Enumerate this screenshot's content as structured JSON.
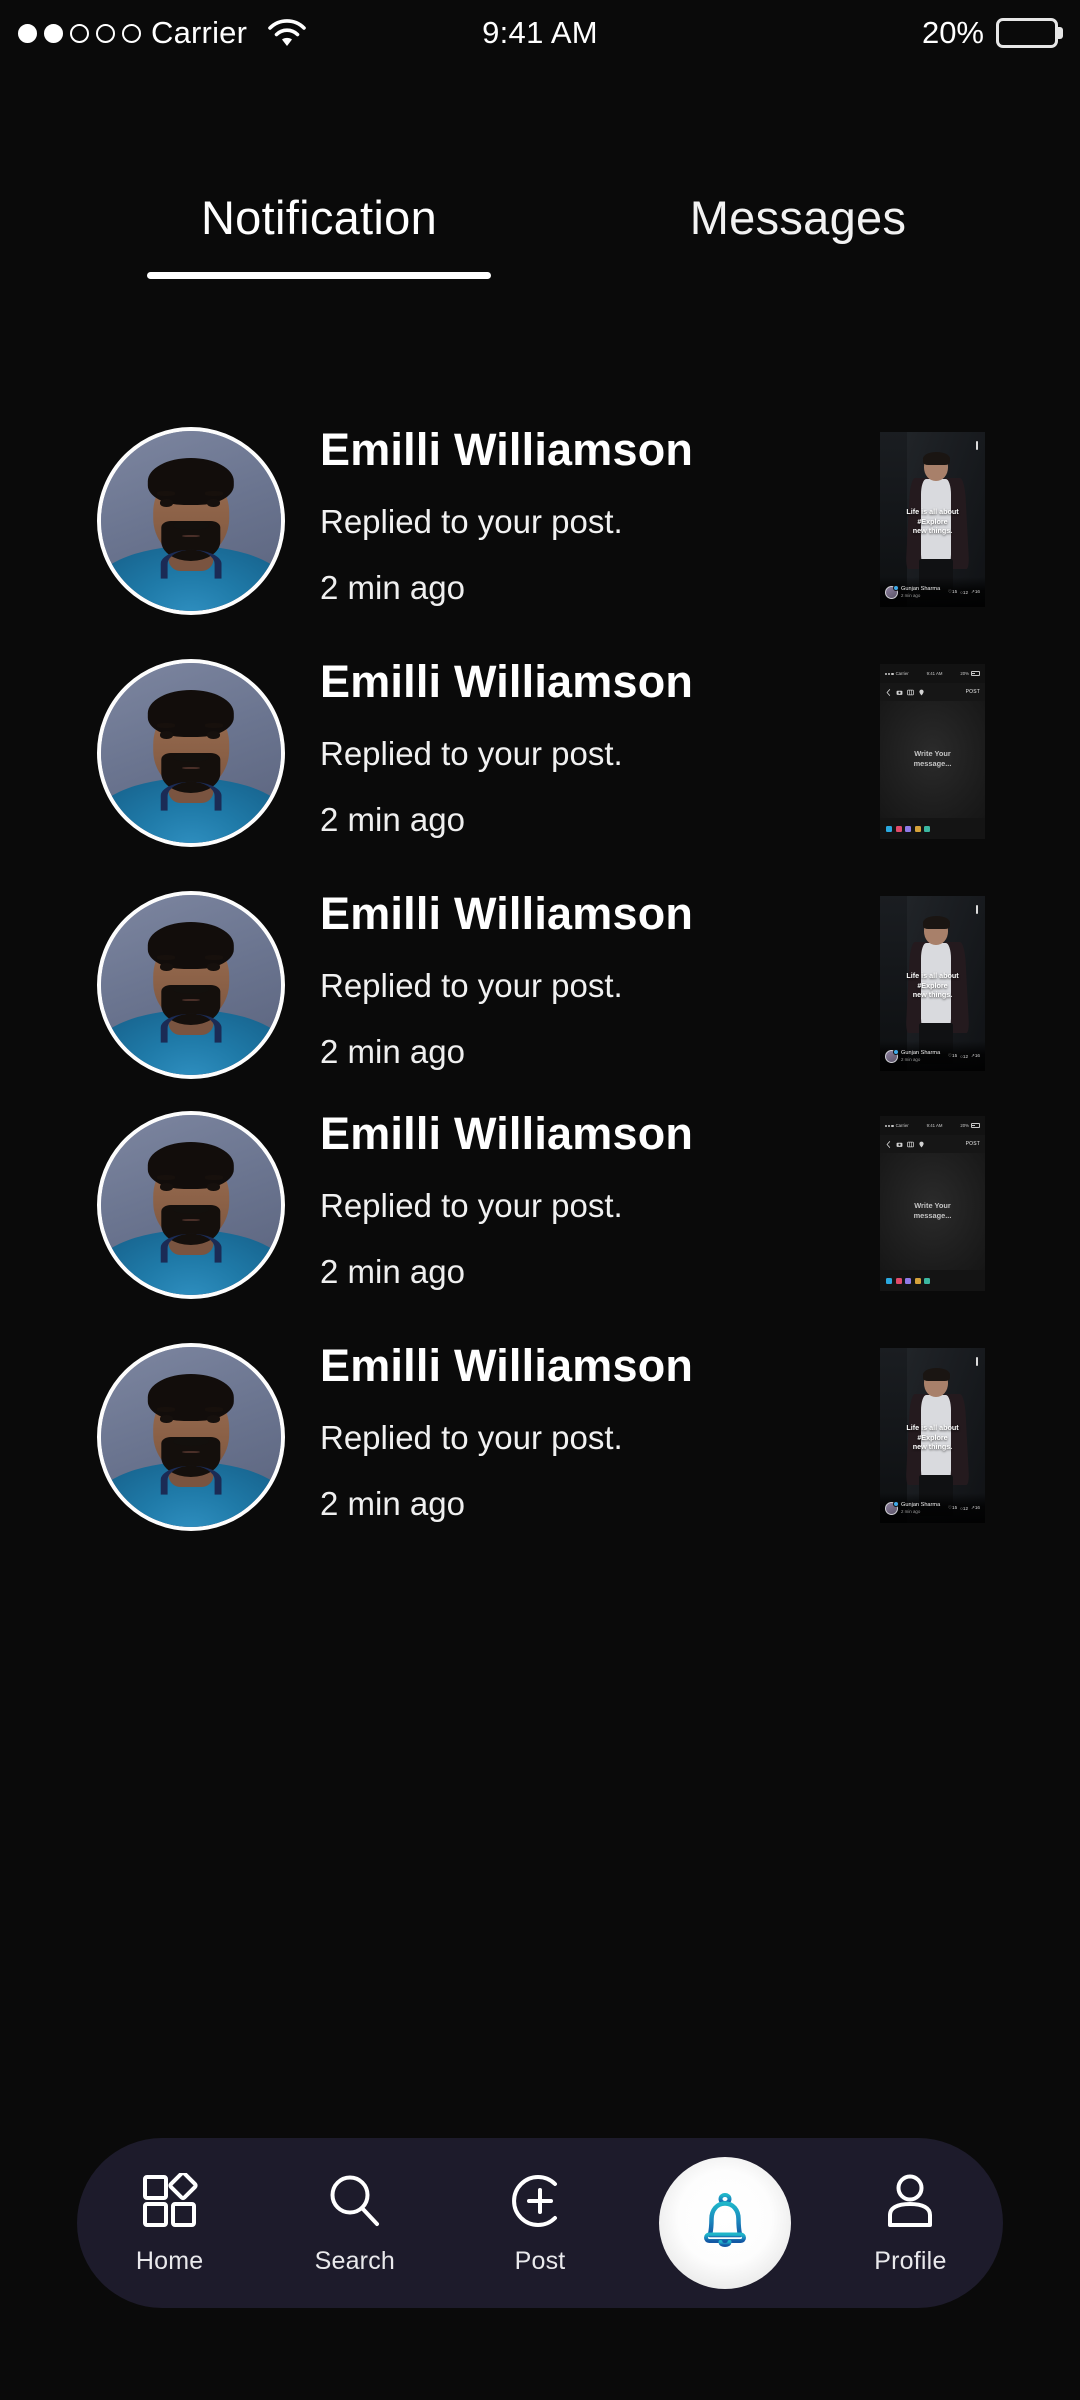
{
  "status_bar": {
    "signal_dots_filled": 2,
    "signal_dots_total": 5,
    "carrier": "Carrier",
    "wifi_icon": "wifi-icon",
    "time": "9:41 AM",
    "battery_percent": "20%",
    "battery_level": 20
  },
  "tabs": {
    "items": [
      {
        "label": "Notification",
        "active": true
      },
      {
        "label": "Messages",
        "active": false
      }
    ]
  },
  "notifications": [
    {
      "name": "Emilli Williamson",
      "action": "Replied to your post.",
      "time": "2 min ago",
      "avatar_name": "user-avatar",
      "thumbnail_type": "post"
    },
    {
      "name": "Emilli Williamson",
      "action": "Replied to your post.",
      "time": "2 min ago",
      "avatar_name": "user-avatar",
      "thumbnail_type": "compose"
    },
    {
      "name": "Emilli Williamson",
      "action": "Replied to your post.",
      "time": "2 min ago",
      "avatar_name": "user-avatar",
      "thumbnail_type": "post"
    },
    {
      "name": "Emilli Williamson",
      "action": "Replied to your post.",
      "time": "2 min ago",
      "avatar_name": "user-avatar",
      "thumbnail_type": "compose"
    },
    {
      "name": "Emilli Williamson",
      "action": "Replied to your post.",
      "time": "2 min ago",
      "avatar_name": "user-avatar",
      "thumbnail_type": "post"
    }
  ],
  "post_thumbnail": {
    "caption_line1": "Life is all about",
    "caption_line2": "#Explore",
    "caption_line3": "new things.",
    "author": "Gunjan Sharma",
    "ago": "2 min ago",
    "likes": "15",
    "comments": "12",
    "shares": "16"
  },
  "compose_thumbnail": {
    "carrier": "Carrier",
    "time": "9:41 AM",
    "battery": "20%",
    "post_button": "POST",
    "placeholder_line1": "Write Your",
    "placeholder_line2": "message..."
  },
  "bottom_nav": {
    "items": [
      {
        "label": "Home",
        "icon": "grid-diamond-icon",
        "active": false
      },
      {
        "label": "Search",
        "icon": "search-icon",
        "active": false
      },
      {
        "label": "Post",
        "icon": "plus-circle-icon",
        "active": false
      },
      {
        "label": "",
        "icon": "bell-icon",
        "active": true
      },
      {
        "label": "Profile",
        "icon": "person-icon",
        "active": false
      }
    ]
  },
  "colors": {
    "background": "#0a0a0a",
    "nav_background": "#1d1b2b",
    "accent_bell_top": "#1fb6c9",
    "accent_bell_bottom": "#1563a8",
    "text_primary": "#ffffff",
    "shirt_blue": "#1f7aa8"
  }
}
